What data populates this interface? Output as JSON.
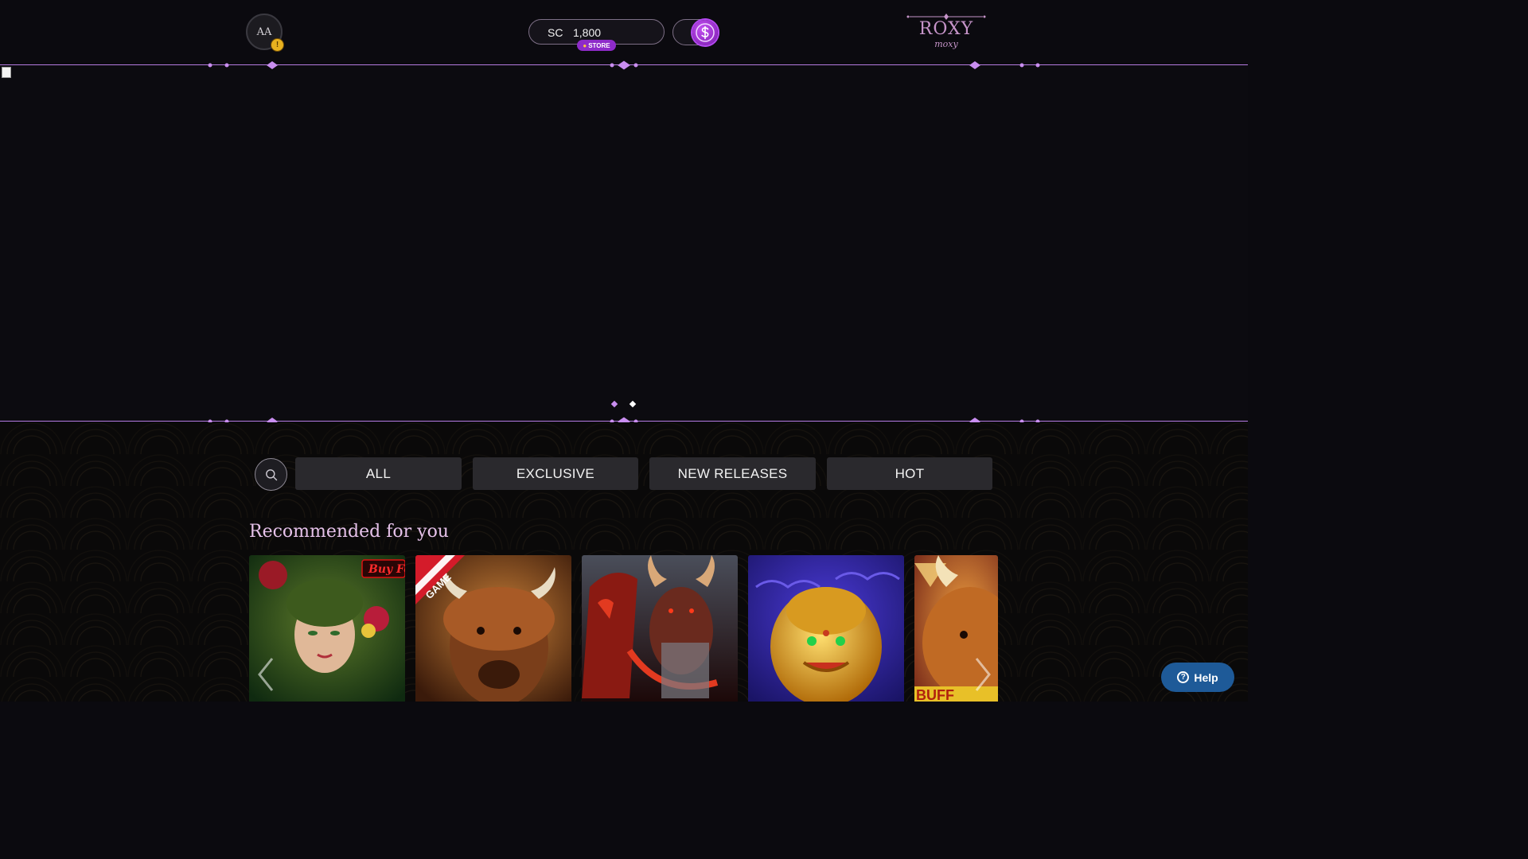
{
  "header": {
    "avatar_initials": "AA",
    "avatar_badge": "!",
    "balance": {
      "currency": "SC",
      "amount": "1,800"
    },
    "store_label": "STORE",
    "currency_toggle_icon": "sweeps-coin-icon",
    "logo": {
      "title": "ROXY",
      "subtitle": "moxy"
    }
  },
  "banner": {
    "slides_count": 2,
    "active_slide": 1
  },
  "filters": {
    "search_icon": "search-icon",
    "tabs": [
      {
        "label": "ALL"
      },
      {
        "label": "EXCLUSIVE"
      },
      {
        "label": "NEW RELEASES"
      },
      {
        "label": "HOT"
      }
    ]
  },
  "recommended": {
    "title": "Recommended for you",
    "cards": [
      {
        "ribbon": "Buy Fe"
      },
      {
        "ribbon": "GAME"
      },
      {
        "ribbon": ""
      },
      {
        "ribbon": ""
      },
      {
        "ribbon": ""
      }
    ]
  },
  "help": {
    "label": "Help"
  },
  "colors": {
    "accent": "#b57be0",
    "tab_bg": "#2a292d",
    "help_bg": "#1e5a98",
    "title": "#e6c2ea"
  }
}
